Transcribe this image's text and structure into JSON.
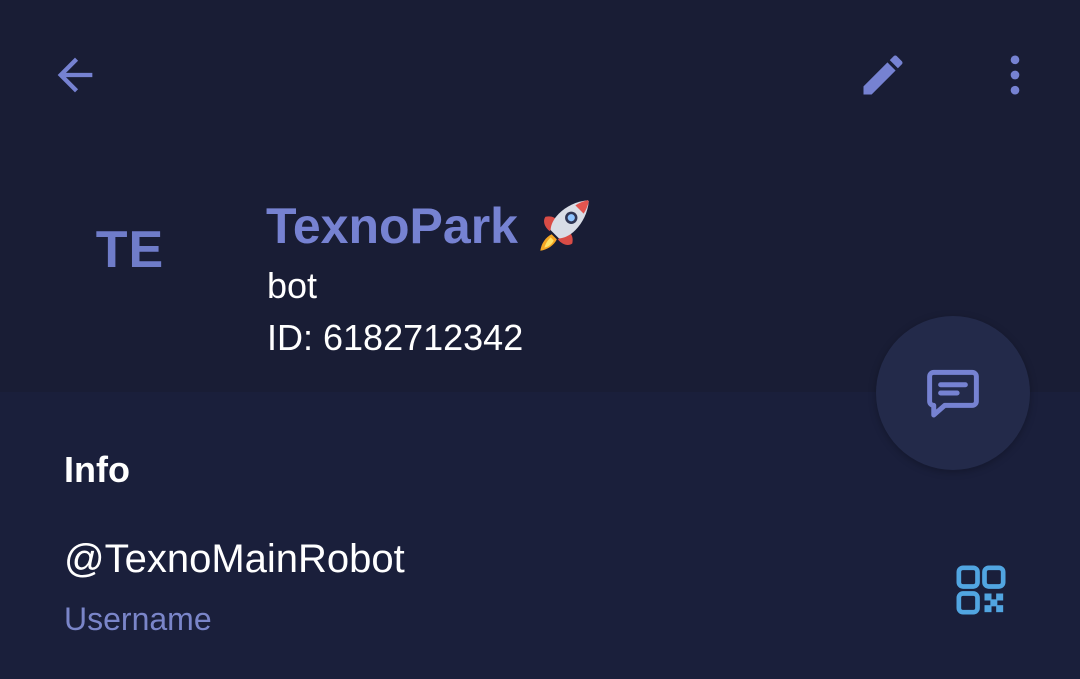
{
  "app": {
    "colors": {
      "header_bg": "#191d35",
      "body_bg": "#1a1f3b",
      "accent": "#7682d2",
      "qr_accent": "#51a5e1",
      "text_primary": "#ffffff",
      "text_secondary": "#7a85c9"
    }
  },
  "toolbar": {
    "back_icon": "arrow-left-icon",
    "edit_icon": "pencil-icon",
    "more_icon": "vertical-dots-icon"
  },
  "profile": {
    "avatar_initials": "TE",
    "name": "TexnoPark",
    "name_emoji_icon": "rocket-icon",
    "status": "bot",
    "id_text": "ID: 6182712342"
  },
  "fab": {
    "icon": "message-icon"
  },
  "info": {
    "title": "Info",
    "username": {
      "value": "@TexnoMainRobot",
      "label": "Username",
      "qr_icon": "qr-code-icon"
    }
  }
}
